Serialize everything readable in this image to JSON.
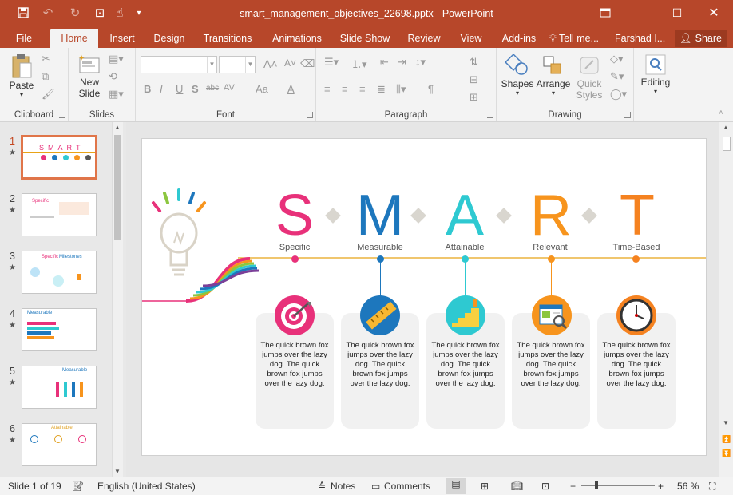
{
  "window": {
    "title": "smart_management_objectives_22698.pptx - PowerPoint"
  },
  "tabs": [
    {
      "label": "File",
      "active": false
    },
    {
      "label": "Home",
      "active": true
    },
    {
      "label": "Insert",
      "active": false
    },
    {
      "label": "Design",
      "active": false
    },
    {
      "label": "Transitions",
      "active": false
    },
    {
      "label": "Animations",
      "active": false
    },
    {
      "label": "Slide Show",
      "active": false
    },
    {
      "label": "Review",
      "active": false
    },
    {
      "label": "View",
      "active": false
    },
    {
      "label": "Add-ins",
      "active": false
    }
  ],
  "tell_me": "Tell me...",
  "user": "Farshad I...",
  "share": "Share",
  "ribbon": {
    "clipboard": {
      "label": "Clipboard",
      "paste": "Paste"
    },
    "slides": {
      "label": "Slides",
      "new_slide": "New",
      "new_slide2": "Slide"
    },
    "font": {
      "label": "Font",
      "font_name": "",
      "font_size": "",
      "bold": "B",
      "italic": "I",
      "underline": "U",
      "strike": "S",
      "shadow": "abc",
      "spacing": "AV",
      "case": "Aa",
      "color": "A"
    },
    "paragraph": {
      "label": "Paragraph"
    },
    "drawing": {
      "label": "Drawing",
      "shapes": "Shapes",
      "arrange": "Arrange",
      "quick": "Quick",
      "styles": "Styles"
    },
    "editing": {
      "label": "Editing"
    }
  },
  "slides_pane": {
    "items": [
      {
        "num": "1",
        "selected": true
      },
      {
        "num": "2",
        "selected": false
      },
      {
        "num": "3",
        "selected": false
      },
      {
        "num": "4",
        "selected": false
      },
      {
        "num": "5",
        "selected": false
      },
      {
        "num": "6",
        "selected": false
      }
    ],
    "thumb_text": {
      "t1": "S·M·A·R·T",
      "t2": "Specific",
      "t3a": "Specific",
      "t3b": "Milestones",
      "t4": "Measurable",
      "t5": "Measurable",
      "t6": "Attainable"
    }
  },
  "slide": {
    "letters": [
      {
        "char": "S",
        "word": "Specific",
        "color": "#e8317a"
      },
      {
        "char": "M",
        "word": "Measurable",
        "color": "#1d77bd"
      },
      {
        "char": "A",
        "word": "Attainable",
        "color": "#2ec9d1"
      },
      {
        "char": "R",
        "word": "Relevant",
        "color": "#f7941d"
      },
      {
        "char": "T",
        "word": "Time-Based",
        "color": "#f58220"
      }
    ],
    "card_text": "The quick brown fox jumps over the lazy dog. The quick brown fox jumps over the lazy dog.",
    "line_color": "#e8a317"
  },
  "status": {
    "slide": "Slide 1 of 19",
    "language": "English (United States)",
    "notes": "Notes",
    "comments": "Comments",
    "zoom": "56 %"
  }
}
